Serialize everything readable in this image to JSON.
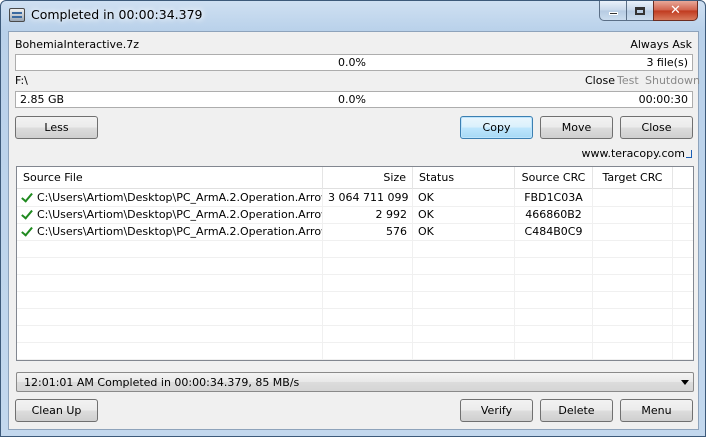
{
  "window": {
    "title": "Completed in 00:00:34.379"
  },
  "source": {
    "name": "BohemiaInteractive.7z",
    "mode": "Always Ask",
    "progress_text": "0.0%",
    "files_text": "3 file(s)"
  },
  "target": {
    "path": "F:\\",
    "after_options": [
      "Close",
      "Test",
      "Shutdown"
    ],
    "size_text": "2.85 GB",
    "progress_text": "0.0%",
    "time_text": "00:00:30"
  },
  "buttons": {
    "less": "Less",
    "copy": "Copy",
    "move": "Move",
    "close": "Close",
    "clean_up": "Clean Up",
    "verify": "Verify",
    "delete": "Delete",
    "menu": "Menu"
  },
  "website": "www.teracopy.com",
  "table": {
    "columns": [
      "Source File",
      "Size",
      "Status",
      "Source CRC",
      "Target CRC"
    ],
    "rows": [
      {
        "file": "C:\\Users\\Artiom\\Desktop\\PC_ArmA.2.Operation.Arrow...",
        "size": "3 064 711 099",
        "status": "OK",
        "source_crc": "FBD1C03A",
        "target_crc": ""
      },
      {
        "file": "C:\\Users\\Artiom\\Desktop\\PC_ArmA.2.Operation.Arrow...",
        "size": "2 992",
        "status": "OK",
        "source_crc": "466860B2",
        "target_crc": ""
      },
      {
        "file": "C:\\Users\\Artiom\\Desktop\\PC_ArmA.2.Operation.Arrow...",
        "size": "576",
        "status": "OK",
        "source_crc": "C484B0C9",
        "target_crc": ""
      }
    ]
  },
  "status_log": {
    "selected": "12:01:01 AM Completed in 00:00:34.379, 85 MB/s"
  },
  "icons": {
    "app": "teracopy-icon",
    "row_status": "check-icon"
  }
}
